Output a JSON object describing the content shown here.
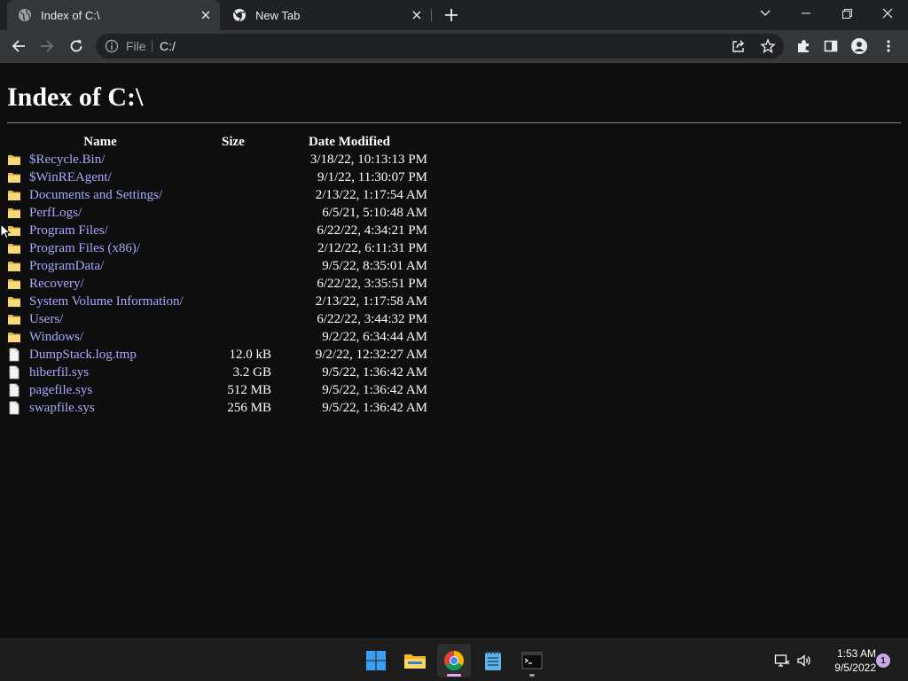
{
  "browser": {
    "tabs": [
      {
        "title": "Index of C:\\",
        "active": true
      },
      {
        "title": "New Tab",
        "active": false
      }
    ],
    "omnibox": {
      "scheme_label": "File",
      "url": "C:/"
    }
  },
  "page": {
    "heading": "Index of C:\\",
    "columns": {
      "name": "Name",
      "size": "Size",
      "date": "Date Modified"
    },
    "entries": [
      {
        "name": "$Recycle.Bin/",
        "size": "",
        "date": "3/18/22, 10:13:13 PM",
        "type": "folder"
      },
      {
        "name": "$WinREAgent/",
        "size": "",
        "date": "9/1/22, 11:30:07 PM",
        "type": "folder"
      },
      {
        "name": "Documents and Settings/",
        "size": "",
        "date": "2/13/22, 1:17:54 AM",
        "type": "folder"
      },
      {
        "name": "PerfLogs/",
        "size": "",
        "date": "6/5/21, 5:10:48 AM",
        "type": "folder"
      },
      {
        "name": "Program Files/",
        "size": "",
        "date": "6/22/22, 4:34:21 PM",
        "type": "folder"
      },
      {
        "name": "Program Files (x86)/",
        "size": "",
        "date": "2/12/22, 6:11:31 PM",
        "type": "folder"
      },
      {
        "name": "ProgramData/",
        "size": "",
        "date": "9/5/22, 8:35:01 AM",
        "type": "folder"
      },
      {
        "name": "Recovery/",
        "size": "",
        "date": "6/22/22, 3:35:51 PM",
        "type": "folder"
      },
      {
        "name": "System Volume Information/",
        "size": "",
        "date": "2/13/22, 1:17:58 AM",
        "type": "folder"
      },
      {
        "name": "Users/",
        "size": "",
        "date": "6/22/22, 3:44:32 PM",
        "type": "folder"
      },
      {
        "name": "Windows/",
        "size": "",
        "date": "9/2/22, 6:34:44 AM",
        "type": "folder"
      },
      {
        "name": "DumpStack.log.tmp",
        "size": "12.0 kB",
        "date": "9/2/22, 12:32:27 AM",
        "type": "file"
      },
      {
        "name": "hiberfil.sys",
        "size": "3.2 GB",
        "date": "9/5/22, 1:36:42 AM",
        "type": "file"
      },
      {
        "name": "pagefile.sys",
        "size": "512 MB",
        "date": "9/5/22, 1:36:42 AM",
        "type": "file"
      },
      {
        "name": "swapfile.sys",
        "size": "256 MB",
        "date": "9/5/22, 1:36:42 AM",
        "type": "file"
      }
    ]
  },
  "taskbar": {
    "apps": [
      "start-icon",
      "file-explorer-icon",
      "chrome-icon",
      "notepad-icon",
      "terminal-icon"
    ],
    "clock": {
      "time": "1:53 AM",
      "date": "9/5/2022"
    },
    "notification_count": "1"
  },
  "colors": {
    "link": "#a8a8ff",
    "page_bg": "#0e0e0e",
    "tab_active": "#35363a",
    "tabstrip": "#202124"
  }
}
